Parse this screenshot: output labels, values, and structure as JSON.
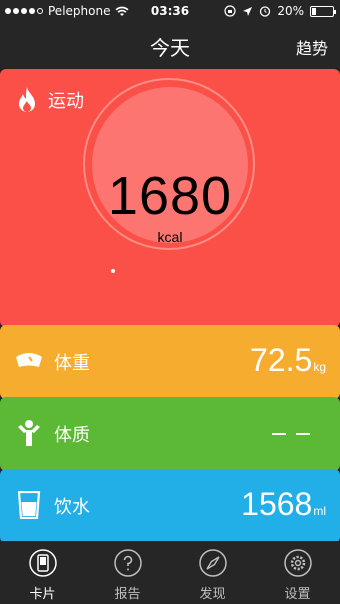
{
  "status_bar": {
    "carrier": "Pelephone",
    "time": "03:36",
    "battery": "20%",
    "battery_level": 0.2
  },
  "nav": {
    "title": "今天",
    "trend_button": "趋势"
  },
  "exercise": {
    "label": "运动",
    "value": "1680",
    "unit": "kcal",
    "icon": "flame-icon"
  },
  "weight": {
    "label": "体重",
    "value": "72.5",
    "unit": "kg",
    "icon": "scale-icon"
  },
  "body_composition": {
    "label": "体质",
    "value": "— —",
    "icon": "body-icon"
  },
  "water": {
    "label": "饮水",
    "value": "1568",
    "unit": "ml",
    "icon": "cup-icon"
  },
  "tabs": [
    {
      "label": "卡片",
      "icon": "card-icon",
      "active": true
    },
    {
      "label": "报告",
      "icon": "question-icon",
      "active": false
    },
    {
      "label": "发现",
      "icon": "compass-icon",
      "active": false
    },
    {
      "label": "设置",
      "icon": "gear-icon",
      "active": false
    }
  ],
  "colors": {
    "exercise": "#fa5047",
    "weight": "#f6ad2f",
    "body": "#5cb935",
    "water": "#22aee6",
    "bar": "#262626"
  }
}
